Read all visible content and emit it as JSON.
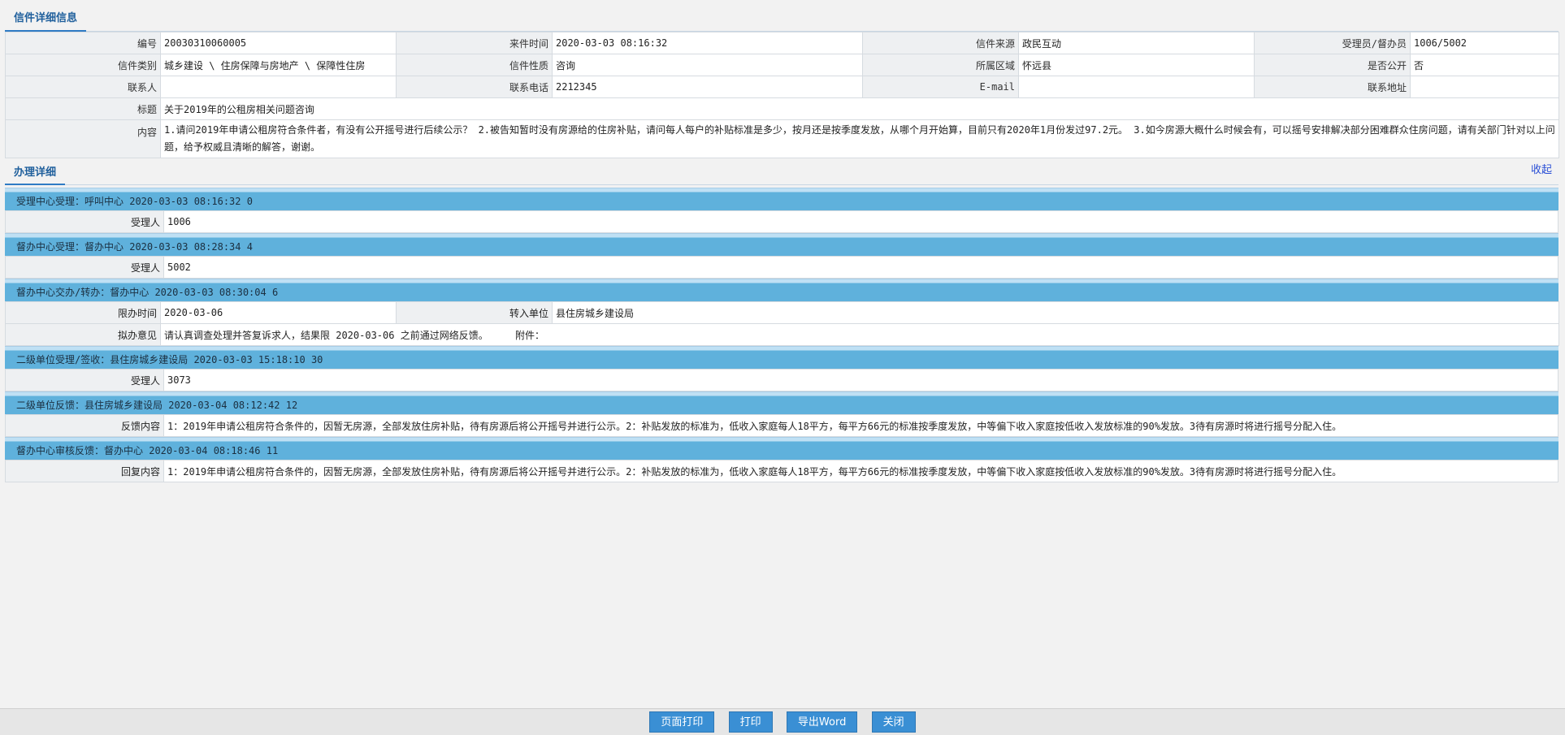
{
  "header": {
    "title": "信件详细信息"
  },
  "letter": {
    "rows": [
      [
        {
          "label": "编号",
          "value": "20030310060005"
        },
        {
          "label": "来件时间",
          "value": "2020-03-03 08:16:32"
        },
        {
          "label": "信件来源",
          "value": "政民互动"
        },
        {
          "label": "受理员/督办员",
          "value": "1006/5002"
        }
      ],
      [
        {
          "label": "信件类别",
          "value": "城乡建设 \\ 住房保障与房地产 \\ 保障性住房"
        },
        {
          "label": "信件性质",
          "value": "咨询"
        },
        {
          "label": "所属区域",
          "value": "怀远县"
        },
        {
          "label": "是否公开",
          "value": "否"
        }
      ],
      [
        {
          "label": "联系人",
          "value": ""
        },
        {
          "label": "联系电话",
          "value": "2212345"
        },
        {
          "label": "E-mail",
          "value": ""
        },
        {
          "label": "联系地址",
          "value": ""
        }
      ]
    ],
    "subject_label": "标题",
    "subject": "关于2019年的公租房相关问题咨询",
    "content_label": "内容",
    "content": "1.请问2019年申请公租房符合条件者，有没有公开摇号进行后续公示？ 2.被告知暂时没有房源给的住房补贴，请问每人每户的补贴标准是多少，按月还是按季度发放，从哪个月开始算，目前只有2020年1月份发过97.2元。 3.如今房源大概什么时候会有，可以摇号安排解决部分困难群众住房问题，请有关部门针对以上问题，给予权威且清晰的解答，谢谢。"
  },
  "process": {
    "title": "办理详细",
    "collapse_label": "收起",
    "steps": [
      {
        "head": "受理中心受理：呼叫中心 2020-03-03 08:16:32 0",
        "handler_label": "受理人",
        "handler": "1006"
      },
      {
        "head": "督办中心受理：督办中心 2020-03-03 08:28:34 4",
        "handler_label": "受理人",
        "handler": "5002"
      },
      {
        "head": "督办中心交办/转办：督办中心 2020-03-03 08:30:04 6",
        "deadline_label": "限办时间",
        "deadline": "2020-03-06",
        "transfer_label": "转入单位",
        "transfer": "县住房城乡建设局",
        "opinion_label": "拟办意见",
        "opinion": "请认真调查处理并答复诉求人，结果限 2020-03-06 之前通过网络反馈。",
        "attachment_label": "附件："
      },
      {
        "head": "二级单位受理/签收：县住房城乡建设局 2020-03-03 15:18:10 30",
        "handler_label": "受理人",
        "handler": "3073"
      },
      {
        "head": "二级单位反馈：县住房城乡建设局 2020-03-04 08:12:42 12",
        "feedback_label": "反馈内容",
        "feedback": "1：2019年申请公租房符合条件的，因暂无房源，全部发放住房补贴，待有房源后将公开摇号并进行公示。2：补贴发放的标准为，低收入家庭每人18平方，每平方66元的标准按季度发放，中等偏下收入家庭按低收入发放标准的90%发放。3待有房源时将进行摇号分配入住。"
      },
      {
        "head": "督办中心审核反馈：督办中心 2020-03-04 08:18:46 11",
        "reply_label": "回复内容",
        "reply": "1：2019年申请公租房符合条件的，因暂无房源，全部发放住房补贴，待有房源后将公开摇号并进行公示。2：补贴发放的标准为，低收入家庭每人18平方，每平方66元的标准按季度发放，中等偏下收入家庭按低收入发放标准的90%发放。3待有房源时将进行摇号分配入住。"
      }
    ]
  },
  "footer": {
    "page_print": "页面打印",
    "print": "打印",
    "export_word": "导出Word",
    "close": "关闭"
  }
}
